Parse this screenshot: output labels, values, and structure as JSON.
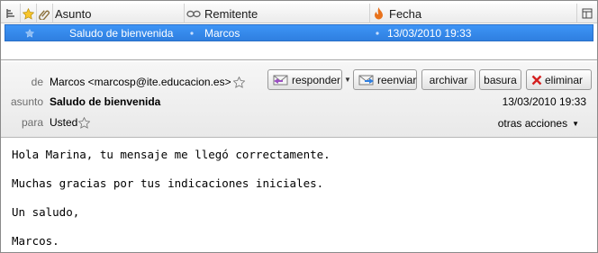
{
  "message_list": {
    "columns": {
      "subject": "Asunto",
      "sender": "Remitente",
      "date": "Fecha"
    },
    "rows": [
      {
        "subject": "Saludo de bienvenida",
        "sender": "Marcos",
        "date": "13/03/2010 19:33",
        "selected": true
      }
    ]
  },
  "message_header": {
    "from_label": "de",
    "from_value": "Marcos <marcosp@ite.educacion.es>",
    "subject_label": "asunto",
    "subject_value": "Saludo de bienvenida",
    "to_label": "para",
    "to_value": "Usted",
    "date": "13/03/2010 19:33",
    "buttons": {
      "reply": "responder",
      "forward": "reenviar",
      "archive": "archivar",
      "junk": "basura",
      "delete": "eliminar"
    },
    "other_actions": "otras acciones"
  },
  "message_body": {
    "lines": [
      "Hola Marina, tu mensaje me llegó correctamente.",
      "Muchas gracias por tus indicaciones iniciales.",
      "Un saludo,",
      "Marcos."
    ]
  },
  "colors": {
    "selection": "#3d94f6",
    "delete_icon": "#d42020",
    "fire_icon": "#e8721c"
  }
}
